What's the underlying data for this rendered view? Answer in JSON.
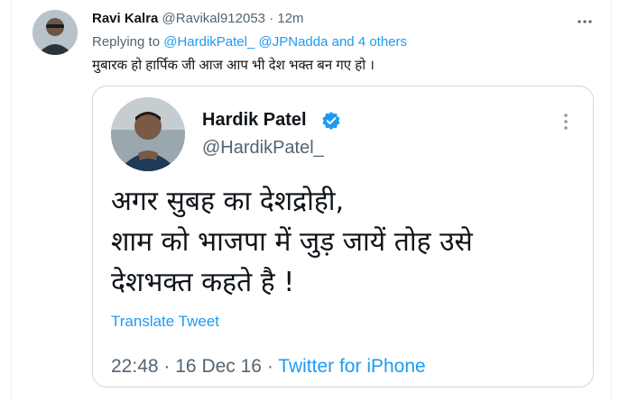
{
  "tweet": {
    "author_name": "Ravi Kalra",
    "author_handle": "@Ravikal912053",
    "separator": "·",
    "time": "12m",
    "reply_prefix": "Replying to",
    "reply_mention_1": "@HardikPatel_",
    "reply_mention_2": "@JPNadda",
    "reply_and": "and",
    "reply_others": "4 others",
    "text": "मुबारक हो हार्पिक जी आज आप भी देश भक्त बन गए हो ।"
  },
  "quoted": {
    "name": "Hardik Patel",
    "handle": "@HardikPatel_",
    "verified": true,
    "body_lines": [
      "अगर सुबह का देशद्रोही,",
      "शाम को भाजपा में जुड़ जायें तोह उसे",
      "देशभक्त कहते है !"
    ],
    "translate_label": "Translate Tweet",
    "time": "22:48",
    "date": "16 Dec 16",
    "separator": "·",
    "source": "Twitter for iPhone"
  },
  "icons": {
    "more": "more-dots-icon",
    "verified": "verified-badge-icon"
  },
  "colors": {
    "link": "#1d9bf0",
    "secondary_text": "#536471",
    "primary_text": "#0f1419",
    "border": "#cfd9de"
  }
}
